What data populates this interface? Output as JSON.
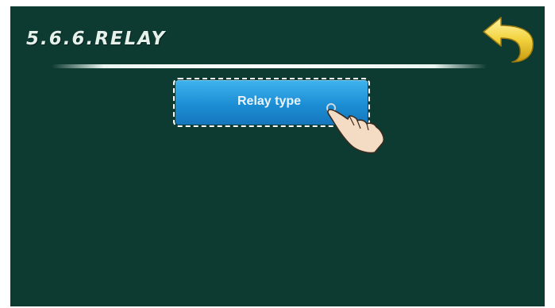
{
  "header": {
    "title": "5.6.6.RELAY",
    "back_icon": "back-arrow-icon"
  },
  "menu": {
    "items": [
      {
        "label": "Relay type",
        "selected": true
      }
    ]
  },
  "pointer_icon": "hand-pointer-icon",
  "colors": {
    "background": "#0d3a31",
    "button": "#1c8ed4",
    "back_arrow": "#f2d23c"
  }
}
